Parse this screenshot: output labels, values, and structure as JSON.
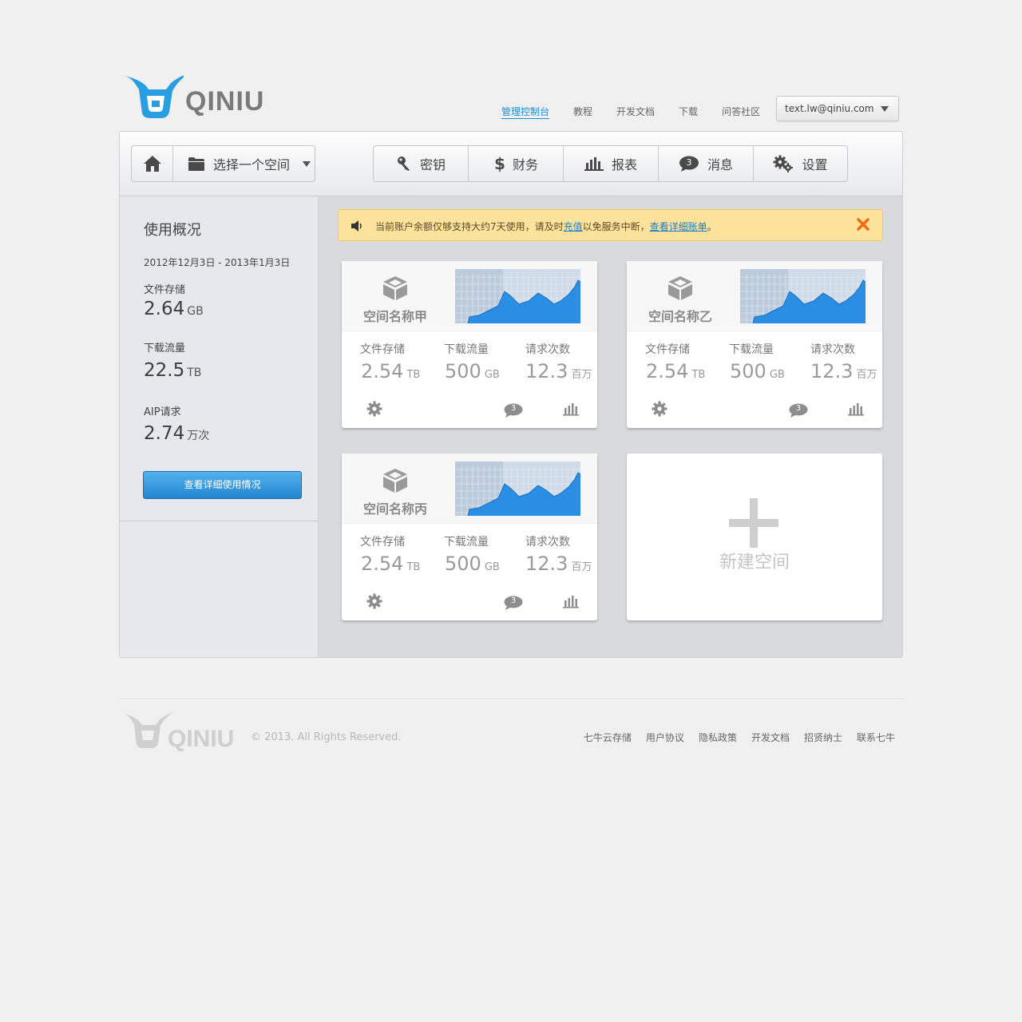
{
  "brand": {
    "name": "QINIU",
    "logo_color": "#2a9ee3"
  },
  "top_nav": {
    "items": [
      {
        "label": "管理控制台",
        "active": true
      },
      {
        "label": "教程"
      },
      {
        "label": "开发文档"
      },
      {
        "label": "下载"
      },
      {
        "label": "问答社区"
      }
    ],
    "user_email": "text.lw@qiniu.com"
  },
  "toolbar": {
    "home_icon": "home-icon",
    "bucket_select": "选择一个空间",
    "tabs": [
      {
        "label": "密钥",
        "icon": "key-icon"
      },
      {
        "label": "财务",
        "icon": "dollar-icon"
      },
      {
        "label": "报表",
        "icon": "bar-chart-icon"
      },
      {
        "label": "消息",
        "icon": "message-icon",
        "badge": "3"
      },
      {
        "label": "设置",
        "icon": "gears-icon"
      }
    ]
  },
  "sidebar": {
    "title": "使用概况",
    "date_range": "2012年12月3日 - 2013年1月3日",
    "stats": [
      {
        "label": "文件存储",
        "value": "2.64",
        "unit": "GB"
      },
      {
        "label": "下载流量",
        "value": "22.5",
        "unit": "TB"
      },
      {
        "label": "AIP请求",
        "value": "2.74",
        "unit": "万次"
      }
    ],
    "detail_button": "查看详细使用情况"
  },
  "alert": {
    "text_before": "当前账户余额仅够支持大约7天使用，请及时",
    "recharge_link": "充值",
    "text_middle": "以免服务中断，",
    "bill_link": "查看详细账单",
    "text_after": "。",
    "accent_color": "#fde29b"
  },
  "buckets": [
    {
      "name": "空间名称甲",
      "metrics": [
        {
          "label": "文件存储",
          "value": "2.54",
          "unit": "TB"
        },
        {
          "label": "下载流量",
          "value": "500",
          "unit": "GB"
        },
        {
          "label": "请求次数",
          "value": "12.3",
          "unit": "百万"
        }
      ],
      "message_count": "3"
    },
    {
      "name": "空间名称乙",
      "metrics": [
        {
          "label": "文件存储",
          "value": "2.54",
          "unit": "TB"
        },
        {
          "label": "下载流量",
          "value": "500",
          "unit": "GB"
        },
        {
          "label": "请求次数",
          "value": "12.3",
          "unit": "百万"
        }
      ],
      "message_count": "3"
    },
    {
      "name": "空间名称丙",
      "metrics": [
        {
          "label": "文件存储",
          "value": "2.54",
          "unit": "TB"
        },
        {
          "label": "下载流量",
          "value": "500",
          "unit": "GB"
        },
        {
          "label": "请求次数",
          "value": "12.3",
          "unit": "百万"
        }
      ],
      "message_count": "3"
    }
  ],
  "new_bucket": "新建空间",
  "footer": {
    "copyright": "© 2013. All Rights Reserved.",
    "links": [
      "七牛云存储",
      "用户协议",
      "隐私政策",
      "开发文档",
      "招贤纳士",
      "联系七牛"
    ]
  }
}
